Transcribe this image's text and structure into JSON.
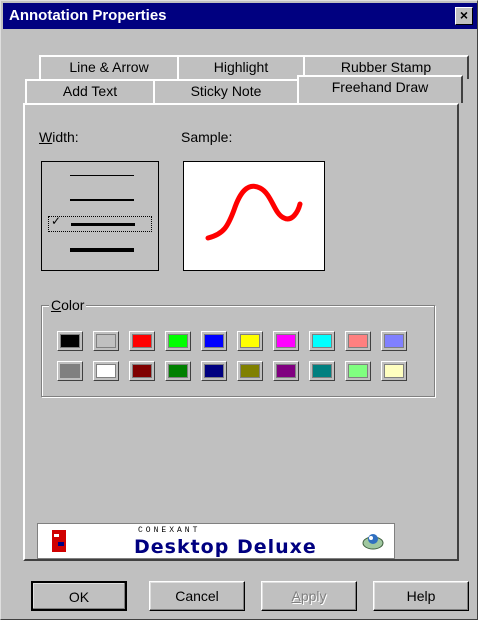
{
  "window": {
    "title": "Annotation Properties",
    "close_glyph": "×"
  },
  "tabs_back": [
    {
      "label": "Line & Arrow"
    },
    {
      "label": "Highlight"
    },
    {
      "label": "Rubber Stamp"
    }
  ],
  "tabs_front": [
    {
      "label": "Add Text"
    },
    {
      "label": "Sticky Note"
    },
    {
      "label": "Freehand Draw",
      "active": true
    }
  ],
  "panel": {
    "width_label_first": "W",
    "width_label_rest": "idth:",
    "sample_label": "Sample:",
    "width_options": [
      {
        "thickness": 1,
        "selected": false
      },
      {
        "thickness": 2,
        "selected": false
      },
      {
        "thickness": 3,
        "selected": true
      },
      {
        "thickness": 4,
        "selected": false
      }
    ],
    "check_glyph": "✓",
    "sample_color": "#ff0000",
    "color_label_first": "C",
    "color_label_rest": "olor",
    "colors_row1": [
      "#000000",
      "#c0c0c0",
      "#ff0000",
      "#00ff00",
      "#0000ff",
      "#ffff00",
      "#ff00ff",
      "#00ffff",
      "#ff8080",
      "#8080ff"
    ],
    "colors_row2": [
      "#808080",
      "#ffffff",
      "#800000",
      "#008000",
      "#000080",
      "#808000",
      "#800080",
      "#008080",
      "#80ff80",
      "#ffffc0"
    ]
  },
  "banner": {
    "small": "CONEXANT",
    "big": "Desktop Deluxe"
  },
  "buttons": {
    "ok": "OK",
    "cancel": "Cancel",
    "apply_first": "A",
    "apply_rest": "pply",
    "help": "Help"
  }
}
